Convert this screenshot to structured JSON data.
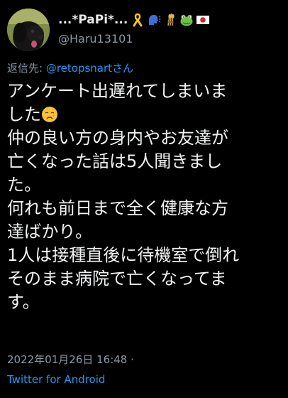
{
  "user": {
    "display_name": "...*PaPi*...",
    "handle": "@Haru13101",
    "name_emojis": [
      "yellow-ribbon-icon",
      "speaking-head-icon",
      "sheaf-of-rice-icon",
      "frog-face-icon",
      "japan-flag-icon"
    ]
  },
  "reply": {
    "prefix": "返信先: ",
    "mention": "@retopsnart",
    "suffix": "さん"
  },
  "tweet": {
    "lines": [
      "アンケート出遅れてしまいま",
      "した",
      "仲の良い方の身内やお友達が",
      "亡くなった話は5人聞きまし",
      "た。",
      "何れも前日まで全く健康な方",
      "達ばかり。",
      "1人は接種直後に待機室で倒れ",
      "そのまま病院で亡くなってま",
      "す。"
    ],
    "inline_emoji": "sad-but-relieved-face-icon"
  },
  "meta": {
    "timestamp": "2022年01月26日 16:48 · ",
    "client": "Twitter for Android"
  },
  "colors": {
    "background": "#000000",
    "text": "#e7e9ea",
    "secondary": "#8b98a5",
    "link": "#1d9bf0"
  }
}
